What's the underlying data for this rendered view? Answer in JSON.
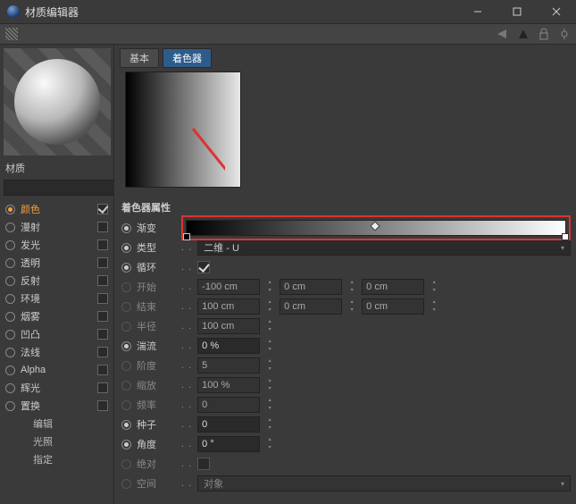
{
  "window": {
    "title": "材质编辑器"
  },
  "toolbar": {},
  "left": {
    "material_label": "材质",
    "search_placeholder": "",
    "channels": [
      {
        "label": "颜色",
        "checked": true,
        "active": true
      },
      {
        "label": "漫射",
        "checked": false,
        "active": false
      },
      {
        "label": "发光",
        "checked": false,
        "active": false
      },
      {
        "label": "透明",
        "checked": false,
        "active": false
      },
      {
        "label": "反射",
        "checked": false,
        "active": false
      },
      {
        "label": "环境",
        "checked": false,
        "active": false
      },
      {
        "label": "烟雾",
        "checked": false,
        "active": false
      },
      {
        "label": "凹凸",
        "checked": false,
        "active": false
      },
      {
        "label": "法线",
        "checked": false,
        "active": false
      },
      {
        "label": "Alpha",
        "checked": false,
        "active": false
      },
      {
        "label": "辉光",
        "checked": false,
        "active": false
      },
      {
        "label": "置换",
        "checked": false,
        "active": false
      }
    ],
    "sub_items": [
      "编辑",
      "光照",
      "指定"
    ]
  },
  "tabs": [
    {
      "label": "基本",
      "active": false
    },
    {
      "label": "着色器",
      "active": true
    }
  ],
  "section_title": "着色器属性",
  "props": {
    "gradient_label": "渐变",
    "type_label": "类型",
    "type_value": "二维 - U",
    "cycle_label": "循环",
    "cycle_checked": true,
    "start_label": "开始",
    "start_values": [
      "-100 cm",
      "0 cm",
      "0 cm"
    ],
    "end_label": "结束",
    "end_values": [
      "100 cm",
      "0 cm",
      "0 cm"
    ],
    "radius_label": "半径",
    "radius_value": "100 cm",
    "turb_label": "湍流",
    "turb_value": "0 %",
    "oct_label": "阶度",
    "oct_value": "5",
    "scale_label": "缩放",
    "scale_value": "100 %",
    "freq_label": "频率",
    "freq_value": "0",
    "seed_label": "种子",
    "seed_value": "0",
    "angle_label": "角度",
    "angle_value": "0 °",
    "absolute_label": "绝对",
    "absolute_checked": false,
    "space_label": "空间",
    "space_value": "对象"
  },
  "chart_data": {
    "type": "line",
    "title": "Gradient",
    "stops": [
      {
        "position": 0.0,
        "color": "#000000"
      },
      {
        "position": 1.0,
        "color": "#ffffff"
      }
    ],
    "interpolation_handle": 0.5
  }
}
